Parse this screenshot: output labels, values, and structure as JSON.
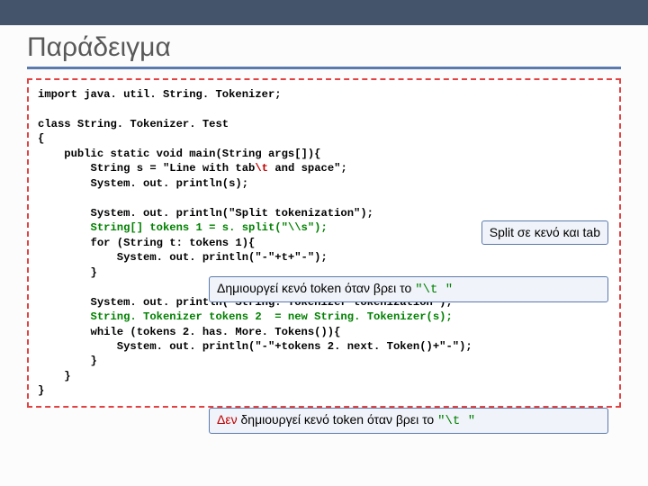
{
  "title": "Παράδειγμα",
  "code": {
    "l1": "import java. util. String. Tokenizer;",
    "l2": "class String. Tokenizer. Test",
    "l3": "{",
    "l4": "    public static void main(String args[]){",
    "l5a": "        String s = \"Line with tab",
    "l5b": "\\t",
    "l5c": " and space\";",
    "l6": "        System. out. println(s);",
    "l7": "        System. out. println(\"Split tokenization\");",
    "l8a": "        ",
    "l8b": "String[] tokens 1 = s. split(\"\\\\s\");",
    "l9": "        for (String t: tokens 1){",
    "l10": "            System. out. println(\"-\"+t+\"-\");",
    "l11": "        }",
    "l12": "        System. out. println(\"String. Tokenizer tokenization\");",
    "l13a": "        ",
    "l13b": "String. Tokenizer tokens 2  = new String. Tokenizer(s);",
    "l14": "        while (tokens 2. has. More. Tokens()){",
    "l15": "            System. out. println(\"-\"+tokens 2. next. Token()+\"-\");",
    "l16": "        }",
    "l17": "    }",
    "l18": "}"
  },
  "callouts": {
    "c1": "Split σε κενό και tab",
    "c2a": "Δημιουργεί κενό token όταν βρει το ",
    "c2b": "\"\\t \"",
    "c3a": "Δεν",
    "c3b": " δημιουργεί κενό token όταν βρει το ",
    "c3c": "\"\\t \""
  }
}
